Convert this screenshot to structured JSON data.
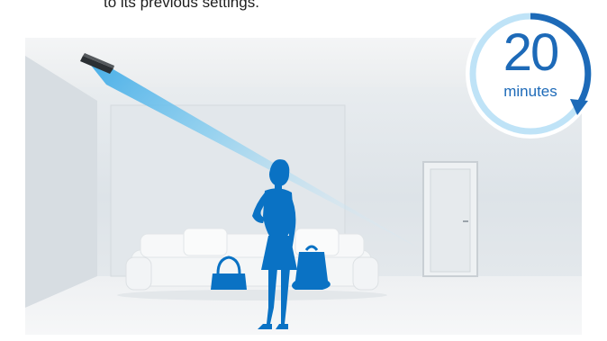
{
  "caption": {
    "text": "to its previous settings."
  },
  "timer": {
    "value": "20",
    "unit": "minutes",
    "accent_color": "#1d6ab8",
    "ring_light_color": "#bfe3f7"
  },
  "scene": {
    "icons": [
      "air-conditioner-icon",
      "woman-silhouette-icon",
      "handbag-icon",
      "shopping-bag-icon",
      "sofa-icon",
      "door-icon"
    ],
    "airflow_color": "#4fb7ea",
    "silhouette_color": "#0a72c4"
  }
}
